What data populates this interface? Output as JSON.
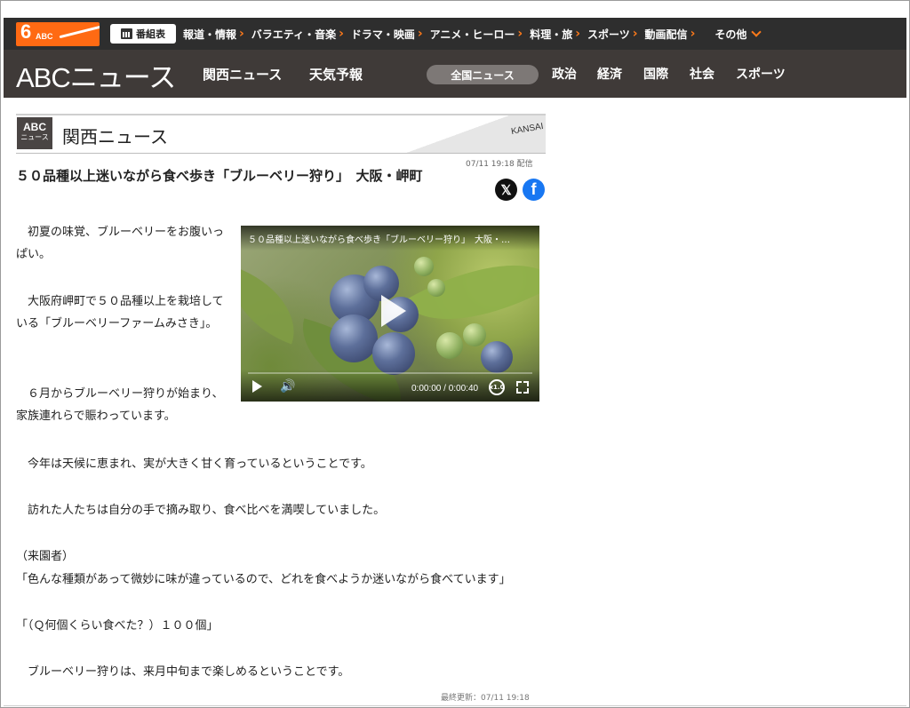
{
  "top_bar": {
    "logo_number": "6",
    "logo_text": "ABC",
    "schedule_label": "番組表",
    "nav": [
      "報道・情報",
      "バラエティ・音楽",
      "ドラマ・映画",
      "アニメ・ヒーロー",
      "料理・旅",
      "スポーツ",
      "動画配信"
    ],
    "other_label": "その他"
  },
  "news_bar": {
    "brand": "ABCニュース",
    "primary_nav": [
      "関西ニュース",
      "天気予報"
    ],
    "active_pill": "全国ニュース",
    "categories": [
      "政治",
      "経済",
      "国際",
      "社会",
      "スポーツ"
    ]
  },
  "section": {
    "logo_line1": "ABC",
    "logo_line2": "ニュース",
    "title": "関西ニュース",
    "tag": "KANSAI"
  },
  "article": {
    "datetime": "07/11 19:18 配信",
    "headline": "５０品種以上迷いながら食べ歩き「ブルーベリー狩り」　大阪・岬町",
    "share": {
      "x_icon": "𝕏",
      "fb_icon": "f"
    },
    "paragraphs": [
      "　初夏の味覚、ブルーベリーをお腹いっぱい。",
      "　大阪府岬町で５０品種以上を栽培している「ブルーベリーファームみさき」。",
      "　６月からブルーベリー狩りが始まり、家族連れらで賑わっています。",
      "　今年は天候に恵まれ、実が大きく甘く育っているということです。",
      "　訪れた人たちは自分の手で摘み取り、食べ比べを満喫していました。",
      "（来園者）",
      "「色んな種類があって微妙に味が違っているので、どれを食べようか迷いながら食べています」",
      "「（Ｑ何個くらい食べた？）１００個」",
      "　ブルーベリー狩りは、来月中旬まで楽しめるということです。"
    ],
    "updated": "最終更新：07/11 19:18"
  },
  "video": {
    "title": "５０品種以上迷いながら食べ歩き「ブルーベリー狩り」　大阪・…",
    "time": "0:00:00 / 0:00:40",
    "speed": "x1.0",
    "volume_icon": "🔊"
  },
  "colors": {
    "accent": "#ff6a13",
    "topbar_bg": "#2e2e2e",
    "newsbar_bg": "#3f3a38",
    "pill_bg": "#7d7876",
    "facebook": "#1877f2"
  }
}
